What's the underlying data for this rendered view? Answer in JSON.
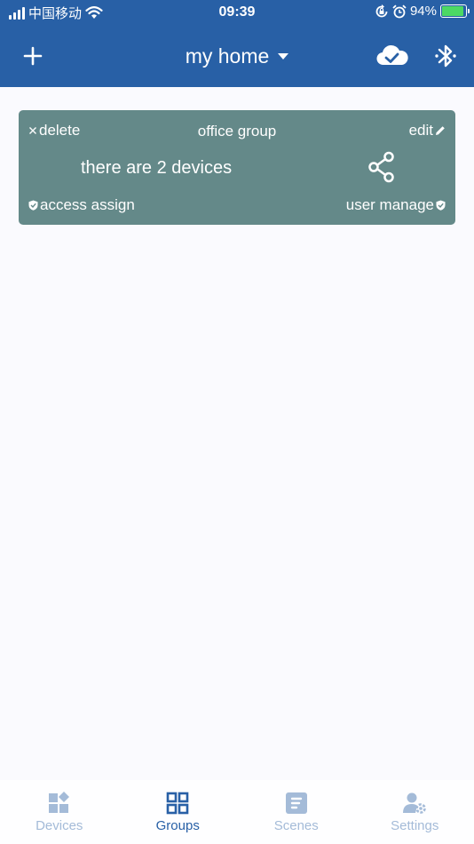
{
  "status_bar": {
    "carrier": "中国移动",
    "time": "09:39",
    "battery": "94%",
    "battery_level": 0.94
  },
  "header": {
    "title": "my home",
    "icons": [
      "plus-icon",
      "chevron-down-icon",
      "cloud-check-icon",
      "bluetooth-icon"
    ]
  },
  "group_card": {
    "delete_label": "delete",
    "title": "office group",
    "edit_label": "edit",
    "device_count": "there are 2 devices",
    "access_label": "access assign",
    "user_manage_label": "user manage"
  },
  "tabs": [
    {
      "label": "Devices",
      "icon": "devices-icon",
      "active": false
    },
    {
      "label": "Groups",
      "icon": "groups-icon",
      "active": true
    },
    {
      "label": "Scenes",
      "icon": "scenes-icon",
      "active": false
    },
    {
      "label": "Settings",
      "icon": "settings-icon",
      "active": false
    }
  ],
  "colors": {
    "header": "#2860a6",
    "card": "#648989",
    "tab_active": "#2860a6",
    "tab_inactive": "#a4bbd8",
    "background": "#fafafe"
  }
}
